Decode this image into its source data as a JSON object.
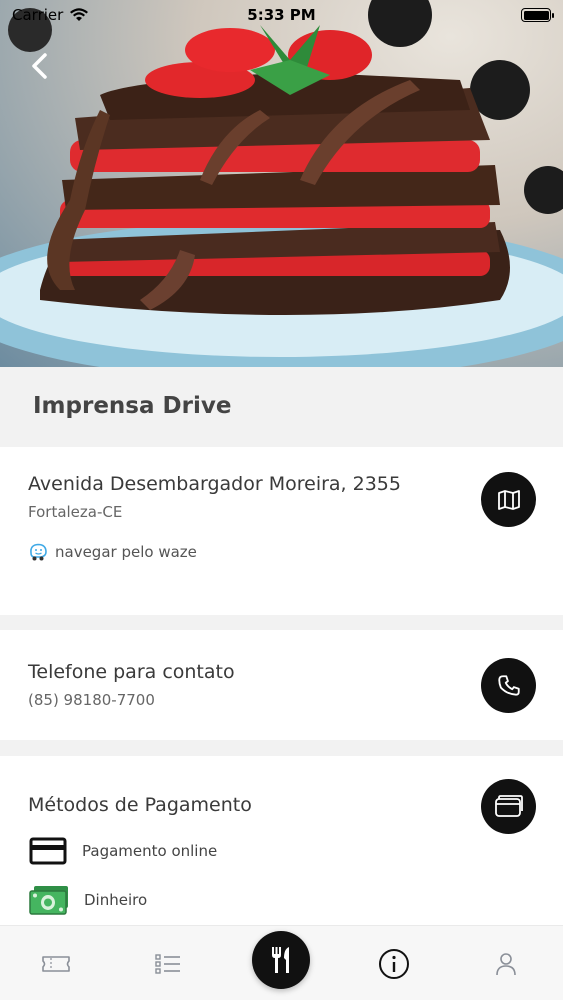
{
  "status_bar": {
    "carrier": "Carrier",
    "time": "5:33 PM"
  },
  "restaurant": {
    "name": "Imprensa Drive"
  },
  "address": {
    "street": "Avenida Desembargador Moreira, 2355",
    "city": "Fortaleza-CE",
    "waze_label": "navegar pelo waze"
  },
  "contact": {
    "title": "Telefone para contato",
    "phone": "(85) 98180-7700"
  },
  "payment": {
    "title": "Métodos de Pagamento",
    "methods": [
      {
        "label": "Pagamento online",
        "icon": "credit-card-icon"
      },
      {
        "label": "Dinheiro",
        "icon": "cash-icon"
      }
    ]
  },
  "tab_bar": {
    "tabs": [
      {
        "icon": "ticket-icon"
      },
      {
        "icon": "list-icon"
      },
      {
        "icon": "fork-knife-icon",
        "active": true
      },
      {
        "icon": "info-icon"
      },
      {
        "icon": "user-icon"
      }
    ]
  },
  "colors": {
    "accent": "#111111",
    "background": "#f2f2f2",
    "card": "#ffffff",
    "waze": "#3fa9e6",
    "cash": "#3aa655"
  }
}
